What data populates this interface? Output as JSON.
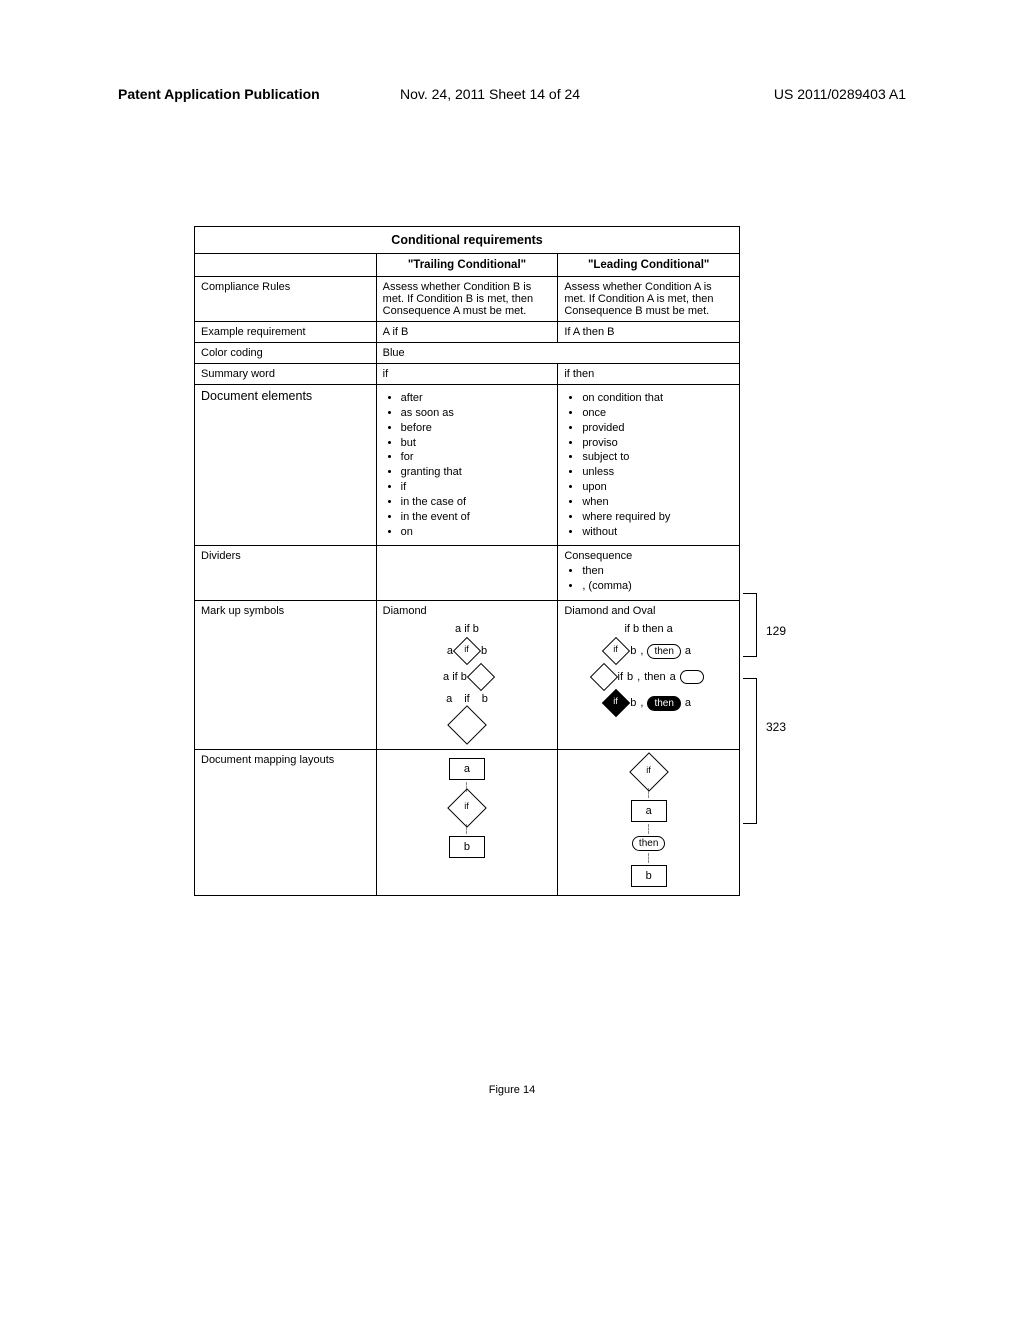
{
  "header": {
    "left": "Patent Application Publication",
    "center": "Nov. 24, 2011  Sheet 14 of 24",
    "right": "US 2011/0289403 A1"
  },
  "table": {
    "title": "Conditional requirements",
    "col2_header": "\"Trailing Conditional\"",
    "col3_header": "\"Leading Conditional\"",
    "rows": {
      "compliance": {
        "label": "Compliance Rules",
        "trailing": "Assess whether Condition B is met. If Condition B is met, then Consequence A must be met.",
        "leading": "Assess whether Condition A is met. If Condition A is met, then Consequence B must be met."
      },
      "example": {
        "label": "Example requirement",
        "trailing": "A if B",
        "leading": "If A then B"
      },
      "color": {
        "label": "Color coding",
        "value": "Blue"
      },
      "summary": {
        "label": "Summary word",
        "trailing": "if",
        "leading": "if then"
      },
      "doc_elements": {
        "label": "Document elements",
        "trailing": [
          "after",
          "as soon as",
          "before",
          "but",
          "for",
          "granting that",
          "if",
          "in the case of",
          "in the event of",
          "on"
        ],
        "leading": [
          "on condition that",
          "once",
          "provided",
          "proviso",
          "subject to",
          "unless",
          "upon",
          "when",
          "where required by",
          "without"
        ]
      },
      "dividers": {
        "label": "Dividers",
        "leading_title": "Consequence",
        "leading_items": [
          "then",
          ", (comma)"
        ]
      },
      "markup": {
        "label": "Mark up symbols",
        "trailing_title": "Diamond",
        "leading_title": "Diamond and Oval",
        "trailing_example": "a if b",
        "leading_example": "if b then a"
      },
      "mapping": {
        "label": "Document mapping layouts"
      }
    }
  },
  "annotations": {
    "a129": "129",
    "a323": "323"
  },
  "figure_caption": "Figure 14",
  "symbols": {
    "if": "if",
    "then": "then",
    "a": "a",
    "b": "b"
  }
}
